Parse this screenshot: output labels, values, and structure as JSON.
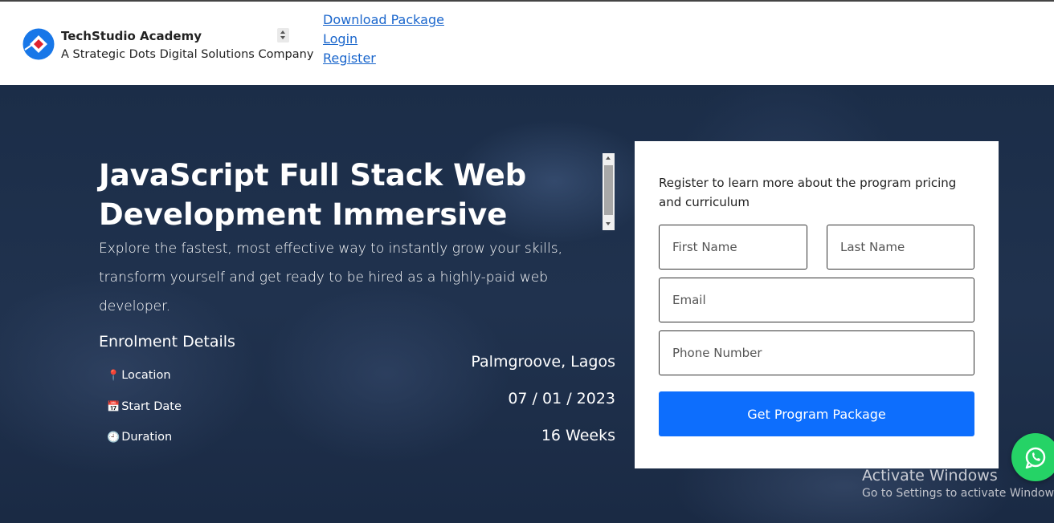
{
  "header": {
    "brand_title": "TechStudio Academy",
    "brand_subtitle": "A Strategic Dots Digital Solutions Company",
    "nav": [
      {
        "label": "Download Package"
      },
      {
        "label": "Login"
      },
      {
        "label": "Register"
      }
    ],
    "logo_icon": "techstudio-logo-icon"
  },
  "hero": {
    "title": "JavaScript Full Stack Web Development Immersive",
    "description": "Explore the fastest, most effective way to instantly grow your skills, transform yourself and get ready to be hired as a highly-paid web developer.",
    "enrolment": {
      "heading": "Enrolment Details",
      "items": [
        {
          "icon": "📍",
          "label": "Location",
          "value": "Palmgroove, Lagos"
        },
        {
          "icon": "📅",
          "label": "Start Date",
          "value": "07 / 01 / 2023"
        },
        {
          "icon": "🕘",
          "label": "Duration",
          "value": "16 Weeks"
        }
      ]
    }
  },
  "form": {
    "intro": "Register to learn more about the program pricing and curriculum",
    "first_name_placeholder": "First Name",
    "last_name_placeholder": "Last Name",
    "email_placeholder": "Email",
    "phone_placeholder": "Phone Number",
    "submit_label": "Get Program Package"
  },
  "watermark": {
    "title": "Activate Windows",
    "subtitle": "Go to Settings to activate Windows."
  },
  "colors": {
    "accent": "#0d6efd",
    "link": "#1a66cc",
    "whatsapp": "#25d366",
    "hero_bg": "#1f314c"
  }
}
